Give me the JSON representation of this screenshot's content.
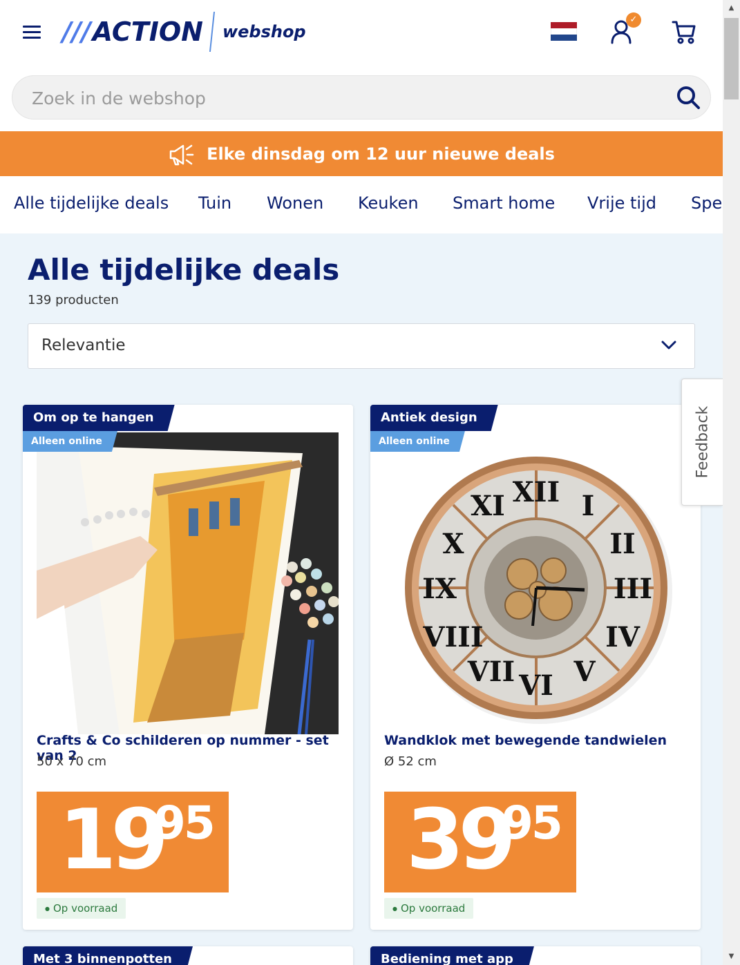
{
  "header": {
    "logo_text": "ACTION",
    "logo_slashes": "///",
    "logo_sub": "webshop",
    "flag_colors": [
      "#ae1c28",
      "#ffffff",
      "#21468b"
    ],
    "user_badge": "✓"
  },
  "search": {
    "placeholder": "Zoek in de webshop"
  },
  "promo": {
    "text": "Elke dinsdag om 12 uur nieuwe deals"
  },
  "categories": [
    "Alle tijdelijke deals",
    "Tuin",
    "Wonen",
    "Keuken",
    "Smart home",
    "Vrije tijd",
    "Spe"
  ],
  "main": {
    "title": "Alle tijdelijke deals",
    "count": "139 producten",
    "sort_value": "Relevantie"
  },
  "products": [
    {
      "tag": "Om op te hangen",
      "badge": "Alleen online",
      "name": "Crafts & Co schilderen op nummer - set van 2",
      "size": "50 x 70 cm",
      "price_euros": "19",
      "price_cents": "95",
      "stock": "Op voorraad"
    },
    {
      "tag": "Antiek design",
      "badge": "Alleen online",
      "name": "Wandklok met bewegende tandwielen",
      "size": "Ø 52 cm",
      "price_euros": "39",
      "price_cents": "95",
      "stock": "Op voorraad"
    }
  ],
  "next_products": [
    {
      "tag": "Met 3 binnenpotten"
    },
    {
      "tag": "Bediening met app"
    }
  ],
  "feedback": {
    "label": "Feedback"
  },
  "colors": {
    "navy": "#0a1e6e",
    "orange": "#f08a34",
    "light_blue": "#5b9ee0",
    "page_bg": "#ecf4fa"
  }
}
